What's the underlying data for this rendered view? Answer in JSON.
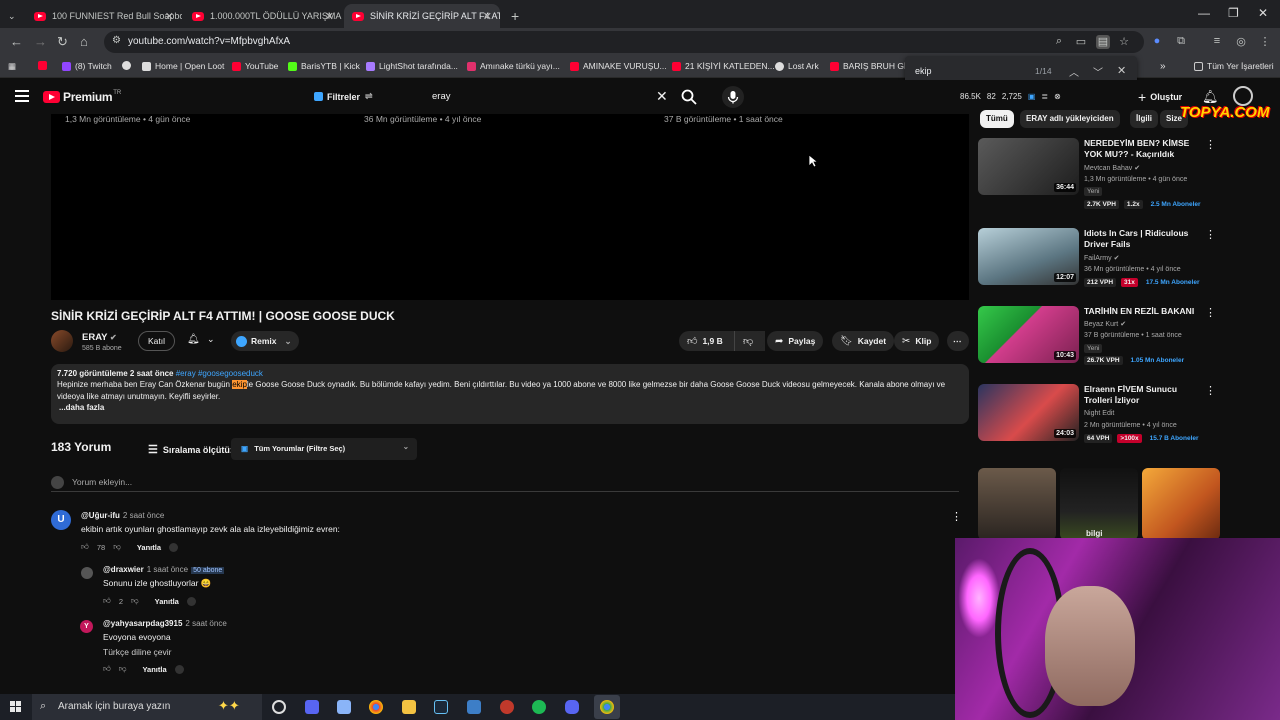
{
  "browser": {
    "tabs": [
      {
        "title": "100 FUNNIEST Red Bull Soapbo",
        "active": false
      },
      {
        "title": "1.000.000TL ÖDÜLLÜ YARIŞMA",
        "active": false
      },
      {
        "title": "SİNİR KRİZİ GEÇİRİP ALT F4 ATT",
        "active": true
      }
    ],
    "new_tab": "+",
    "url": "youtube.com/watch?v=MfpbvghAfxA",
    "bookmarks": [
      {
        "label": "(8) Twitch",
        "color": "#9146ff"
      },
      {
        "label": "Home | Open Loot",
        "color": "#dddddd"
      },
      {
        "label": "YouTube",
        "color": "#ff0033"
      },
      {
        "label": "BarisYTB | Kick",
        "color": "#53fc18"
      },
      {
        "label": "LightShot tarafında...",
        "color": "#a77bff"
      },
      {
        "label": "Amınake türkü yayı...",
        "color": "#e1306c"
      },
      {
        "label": "AMINAKE VURUŞU...",
        "color": "#ff0033"
      },
      {
        "label": "21 KİŞİYİ KATLEDEN...",
        "color": "#ff0033"
      },
      {
        "label": "Lost Ark",
        "color": "#dddddd"
      },
      {
        "label": "BARIŞ BRUH GİTA",
        "color": "#ff0033"
      }
    ],
    "all_bookmarks": "Tüm Yer İşaretleri",
    "find": {
      "query": "ekip",
      "count": "1/14"
    }
  },
  "youtube": {
    "brand": "Premium",
    "country": "TR",
    "filters_label": "Filtreler",
    "search_value": "eray",
    "stats": [
      "86.5K",
      "82",
      "2,725"
    ],
    "create_label": "Oluştur",
    "player_views": [
      "1,3 Mn görüntüleme • 4 gün önce",
      "36 Mn görüntüleme • 4 yıl önce",
      "37 B görüntüleme • 1 saat önce"
    ]
  },
  "video": {
    "title": "SİNİR KRİZİ GEÇİRİP ALT F4 ATTIM! | GOOSE GOOSE DUCK",
    "channel": "ERAY",
    "subscribers": "585 B abone",
    "join_label": "Katıl",
    "remix_label": "Remix",
    "likes": "1,9 B",
    "share_label": "Paylaş",
    "save_label": "Kaydet",
    "clip_label": "Klip",
    "views_meta": "7.720 görüntüleme  2 saat önce",
    "hashtags": "#eray #goosegooseduck",
    "desc_before": "Hepinize merhaba ben Eray Can Özkenar bugün ",
    "desc_highlight": "ekip",
    "desc_after": "le Goose Goose Duck oynadık. Bu bölümde kafayı yedim. Beni çıldırttılar. Bu video ya 1000 abone ve 8000 like gelmezse bir daha Goose Goose Duck videosu gelmeyecek. Kanala abone olmayı ve videoya like atmayı unutmayın. Keyifli seyirler.",
    "more_label": "...daha fazla"
  },
  "comments": {
    "count": "183 Yorum",
    "sort_label": "Sıralama ölçütü:",
    "filter_label": "Tüm Yorumlar (Filtre Seç)",
    "add_placeholder": "Yorum ekleyin...",
    "reply_label": "Yanıtla",
    "items": [
      {
        "user": "@Uğur-ifu",
        "time": "2 saat önce",
        "badge": "",
        "text": "ekibin artık oyunları ghostlamayıp zevk ala ala izleyebildiğimiz evren:",
        "likes": "78",
        "avatar": "U",
        "avatar_color": "#2f6bd6"
      },
      {
        "user": "@draxwier",
        "time": "1 saat önce",
        "badge": "50 abone",
        "text": "Sonunu izle ghostluyorlar 😄",
        "likes": "2",
        "avatar": "",
        "avatar_color": "#555555"
      },
      {
        "user": "@yahyasarpdag3915",
        "time": "2 saat önce",
        "badge": "",
        "text": "Evoyona evoyona",
        "extra": "Türkçe diline çevir",
        "likes": "",
        "avatar": "Y",
        "avatar_color": "#c2185b"
      }
    ]
  },
  "sidebar": {
    "chips": [
      "Tümü",
      "ERAY adlı yükleyiciden",
      "İlgili",
      "Size"
    ],
    "watermark": "TOPYA.COM",
    "recs": [
      {
        "title": "NEREDEYİM BEN? KİMSE YOK MU?? - Kaçırıldık",
        "channel": "Mevtcan Bahav",
        "meta": "1,3 Mn görüntüleme • 4 gün önce",
        "new": "Yeni",
        "duration": "36:44",
        "vph": "2.7K VPH",
        "ratio": "1.2x",
        "subs": "2.5 Mn Aboneler",
        "thumb": "#3b3b3b"
      },
      {
        "title": "Idiots In Cars | Ridiculous Driver Fails",
        "channel": "FailArmy",
        "meta": "36 Mn görüntüleme • 4 yıl önce",
        "new": "",
        "duration": "12:07",
        "vph": "212 VPH",
        "ratio": "31x",
        "subs": "17.5 Mn Aboneler",
        "thumb": "#7f9aa6"
      },
      {
        "title": "TARİHİN EN REZİL BAKANI",
        "channel": "Beyaz Kurt",
        "meta": "37 B görüntüleme • 1 saat önce",
        "new": "Yeni",
        "duration": "10:43",
        "vph": "26.7K VPH",
        "ratio": "",
        "subs": "1.05 Mn Aboneler",
        "thumb": "#d23d8c"
      },
      {
        "title": "Elraenn FİVEM Sunucu Trolleri İzliyor",
        "channel": "Night Edit",
        "meta": "2 Mn görüntüleme • 4 yıl önce",
        "new": "",
        "duration": "24:03",
        "vph": "64 VPH",
        "ratio": ">100x",
        "subs": "15.7 B Aboneler",
        "thumb": "#3a3f55"
      }
    ],
    "short_caption": "bilgi"
  },
  "taskbar": {
    "search_placeholder": "Aramak için buraya yazın"
  }
}
